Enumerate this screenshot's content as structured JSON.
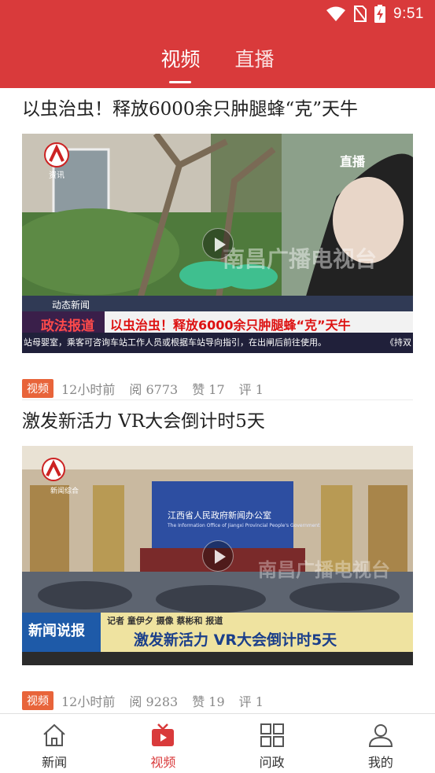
{
  "status_bar": {
    "time": "9:51"
  },
  "header": {
    "tabs": [
      {
        "label": "视频",
        "active": true
      },
      {
        "label": "直播",
        "active": false
      }
    ]
  },
  "feed": [
    {
      "title": "以虫治虫！释放6000余只肿腿蜂“克”天牛",
      "thumbnail": {
        "channel_tag": "资讯",
        "corner_text": "直播",
        "section_text": "动态新闻",
        "program_logo": "政法报道",
        "headline_text": "以虫治虫！释放6000余只肿腿蜂“克”天牛",
        "ticker_text": "站母婴室，乘客可咨询车站工作人员或根据车站导向指引，在出闸后前往使用。",
        "ticker_right": "《持双",
        "watermark": "南昌广播电视台"
      },
      "badge": "视频",
      "time": "12小时前",
      "views": "阅 6773",
      "likes": "赞 17",
      "comments": "评 1"
    },
    {
      "title": "激发新活力 VR大会倒计时5天",
      "thumbnail": {
        "channel_tag": "新闻综合",
        "backdrop_title": "江西省人民政府新闻办公室",
        "backdrop_subtitle": "The Information Office of Jiangxi Provincial People's Government",
        "program_logo": "新闻说报",
        "credit_text": "记者 童伊夕 摄像 蔡彬和 报道",
        "headline_text": "激发新活力 VR大会倒计时5天",
        "watermark": "南昌广播电视台"
      },
      "badge": "视频",
      "time": "12小时前",
      "views": "阅 9283",
      "likes": "赞 19",
      "comments": "评 1"
    }
  ],
  "bottom_nav": [
    {
      "label": "新闻",
      "icon": "home-icon",
      "active": false
    },
    {
      "label": "视频",
      "icon": "tv-icon",
      "active": true
    },
    {
      "label": "问政",
      "icon": "grid-icon",
      "active": false
    },
    {
      "label": "我的",
      "icon": "user-icon",
      "active": false
    }
  ],
  "colors": {
    "brand_red": "#d93a3b",
    "badge_orange": "#e8643a"
  }
}
